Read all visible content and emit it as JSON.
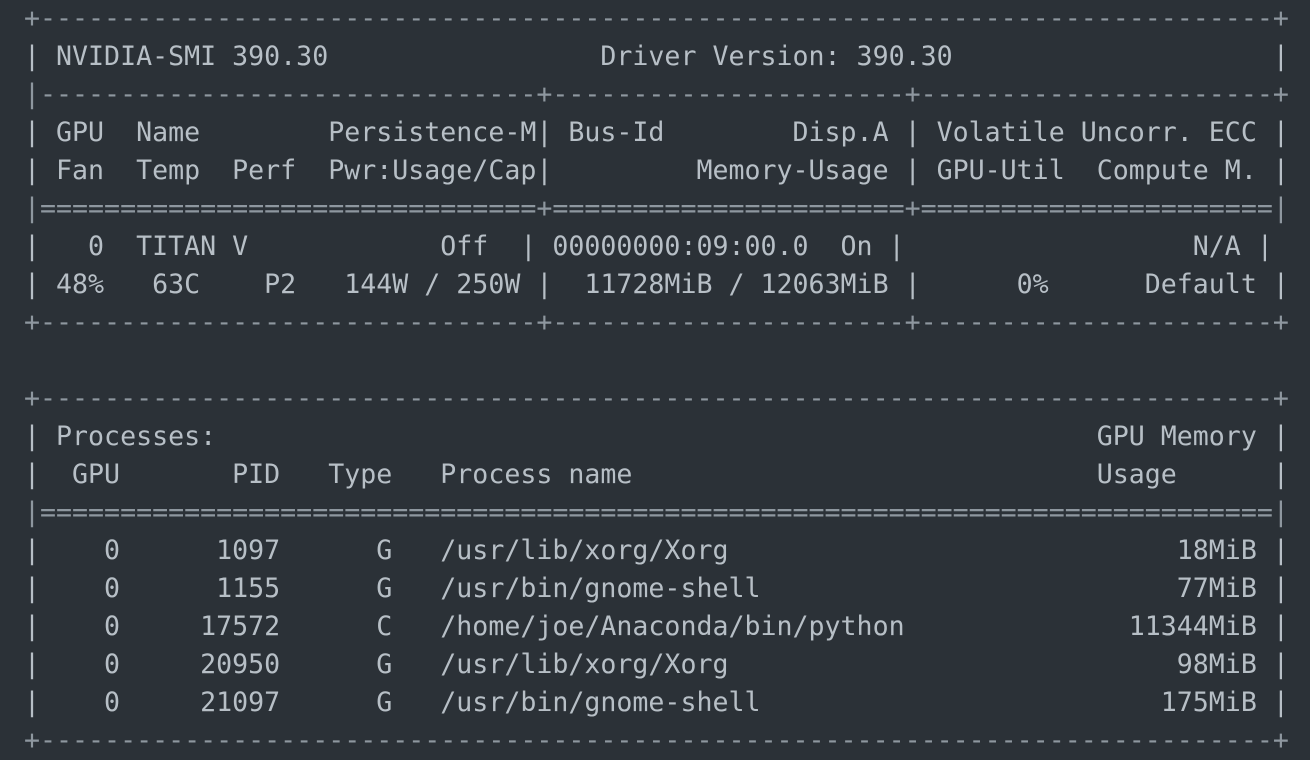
{
  "top_lines": [
    "+-----------------------------------------------------------------------------+",
    "| NVIDIA-SMI 390.30                 Driver Version: 390.30                    |",
    "|-------------------------------+----------------------+----------------------+",
    "| GPU  Name        Persistence-M| Bus-Id        Disp.A | Volatile Uncorr. ECC |",
    "| Fan  Temp  Perf  Pwr:Usage/Cap|         Memory-Usage | GPU-Util  Compute M. |",
    "|===============================+======================+======================|",
    "|   0  TITAN V            Off  | 00000000:09:00.0  On |                  N/A |",
    "| 48%   63C    P2   144W / 250W |  11728MiB / 12063MiB |      0%      Default |",
    "+-------------------------------+----------------------+----------------------+"
  ],
  "proc_lines": [
    "+-----------------------------------------------------------------------------+",
    "| Processes:                                                       GPU Memory |",
    "|  GPU       PID   Type   Process name                             Usage      |",
    "|=============================================================================|",
    "|    0      1097      G   /usr/lib/xorg/Xorg                            18MiB |",
    "|    0      1155      G   /usr/bin/gnome-shell                          77MiB |",
    "|    0     17572      C   /home/joe/Anaconda/bin/python              11344MiB |",
    "|    0     20950      G   /usr/lib/xorg/Xorg                            98MiB |",
    "|    0     21097      G   /usr/bin/gnome-shell                         175MiB |",
    "+-----------------------------------------------------------------------------+"
  ],
  "summary": {
    "smi_version": "NVIDIA-SMI 390.30",
    "driver_version": "390.30",
    "gpu": {
      "index": "0",
      "name": "TITAN V",
      "persistence_mode": "Off",
      "bus_id": "00000000:09:00.0",
      "display_active": "On",
      "volatile_uncorr_ecc": "N/A",
      "fan": "48%",
      "temp": "63C",
      "perf": "P2",
      "power_usage": "144W",
      "power_cap": "250W",
      "memory_used": "11728MiB",
      "memory_total": "12063MiB",
      "gpu_util": "0%",
      "compute_mode": "Default"
    },
    "processes": [
      {
        "gpu": "0",
        "pid": "1097",
        "type": "G",
        "name": "/usr/lib/xorg/Xorg",
        "memory": "18MiB"
      },
      {
        "gpu": "0",
        "pid": "1155",
        "type": "G",
        "name": "/usr/bin/gnome-shell",
        "memory": "77MiB"
      },
      {
        "gpu": "0",
        "pid": "17572",
        "type": "C",
        "name": "/home/joe/Anaconda/bin/python",
        "memory": "11344MiB"
      },
      {
        "gpu": "0",
        "pid": "20950",
        "type": "G",
        "name": "/usr/lib/xorg/Xorg",
        "memory": "98MiB"
      },
      {
        "gpu": "0",
        "pid": "21097",
        "type": "G",
        "name": "/usr/bin/gnome-shell",
        "memory": "175MiB"
      }
    ]
  },
  "colors": {
    "background": "#2b3137",
    "text": "#b7bfc6"
  }
}
